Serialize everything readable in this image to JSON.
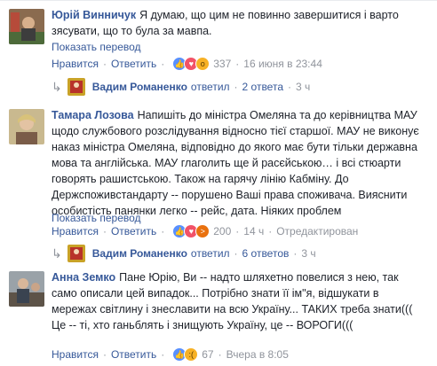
{
  "comments": [
    {
      "author": "Юрій Винничук",
      "text": "Я думаю, що цим не повинно завершитися і варто зясувати, що то була за мавпа.",
      "translate": "Показать перевод",
      "like": "Нравится",
      "reply": "Ответить",
      "reactions": [
        "like",
        "love",
        "wow"
      ],
      "reaction_count": "337",
      "time": "16 июня в 23:44",
      "replies": {
        "name": "Вадим Романенко",
        "action": "ответил",
        "count": "2 ответа",
        "time": "3 ч"
      }
    },
    {
      "author": "Тамара Лозова",
      "text": "Напишіть до міністра Омеляна та до керівництва МАУ щодо службового розслідування відносно тієї старшої. МАУ не виконує наказ міністра Омеляна, відповідно до якого має бути тільки державна мова та англійська. МАУ глаголить ще й расєйською… і всі стюарти говорять рашистською. Також на гарячу лінію Кабміну. До Держспоживстандарту -- порушено Ваші права споживача. Вияснити особистість панянки легко -- рейс, дата. Ніяких проблем",
      "translate": "Показать перевод",
      "like": "Нравится",
      "reply": "Ответить",
      "reactions": [
        "like",
        "love",
        "angry"
      ],
      "reaction_count": "200",
      "time": "14 ч",
      "edited": "Отредактирован",
      "replies": {
        "name": "Вадим Романенко",
        "action": "ответил",
        "count": "6 ответов",
        "time": "3 ч"
      }
    },
    {
      "author": "Анна Земко",
      "text": "Пане Юрію, Ви -- надто шляхетно повелися з нею, так само описали цей випадок... Потрібно знати її ім\"я, відшукати в мережах світлину і знеславити на всю Україну... ТАКИХ треба знати((( Це -- ті, хто ганьблять і знищують Україну, це -- ВОРОГИ(((",
      "like": "Нравится",
      "reply": "Ответить",
      "reactions": [
        "like",
        "sad"
      ],
      "reaction_count": "67",
      "time": "Вчера в 8:05"
    }
  ],
  "separator": "·",
  "colors": {
    "link": "#365899",
    "meta": "#90949c",
    "like": "#5890ff",
    "love": "#f25268",
    "wow": "#f7b125",
    "angry": "#e9710f"
  }
}
